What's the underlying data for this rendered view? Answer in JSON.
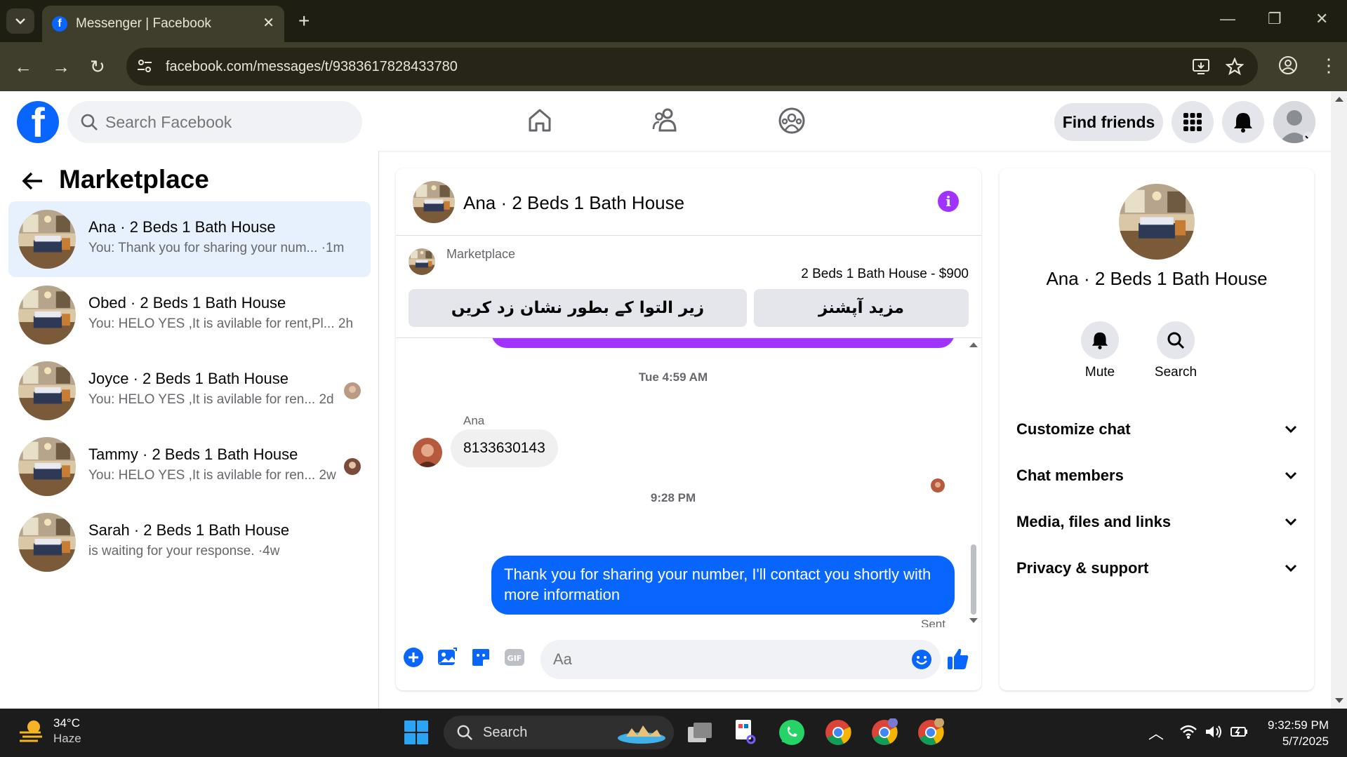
{
  "browser": {
    "tab_title": "Messenger | Facebook",
    "url": "facebook.com/messages/t/9383617828433780"
  },
  "header": {
    "search_placeholder": "Search Facebook",
    "find_friends": "Find friends"
  },
  "sidebar": {
    "title": "Marketplace",
    "conversations": [
      {
        "name": "Ana · 2 Beds 1 Bath House",
        "preview": "You: Thank you for sharing your num... ·1m",
        "active": true
      },
      {
        "name": "Obed · 2 Beds 1 Bath House",
        "preview": "You: HELO YES ,It is avilable for rent,Pl...  2h"
      },
      {
        "name": "Joyce · 2 Beds 1 Bath House",
        "preview": "You: HELO YES ,It is avilable for ren...  2d"
      },
      {
        "name": "Tammy · 2 Beds 1 Bath House",
        "preview": "You: HELO YES ,It is avilable for ren...  2w"
      },
      {
        "name": "Sarah · 2 Beds 1 Bath House",
        "preview": "is waiting for your response. ·4w"
      }
    ]
  },
  "chat": {
    "title": "Ana · 2 Beds 1 Bath House",
    "marketplace_label": "Marketplace",
    "listing_price": "2 Beds 1 Bath House - $900",
    "btn_mark_pending": "زیر التوا کے بطور نشان زد کریں",
    "btn_more_options": "مزید آپشنز",
    "timestamp_1": "Tue 4:59 AM",
    "sender_name": "Ana",
    "incoming_message": "8133630143",
    "timestamp_2": "9:28 PM",
    "outgoing_message": "Thank you for sharing your number, I'll contact you shortly with more information",
    "status": "Sent",
    "input_placeholder": "Aa"
  },
  "info_panel": {
    "name": "Ana · 2 Beds 1 Bath House",
    "mute": "Mute",
    "search": "Search",
    "sections": [
      "Customize chat",
      "Chat members",
      "Media, files and links",
      "Privacy & support"
    ]
  },
  "taskbar": {
    "temperature": "34°C",
    "weather": "Haze",
    "search": "Search",
    "time": "9:32:59 PM",
    "date": "5/7/2025"
  },
  "colors": {
    "facebook_blue": "#0866ff",
    "purple_accent": "#a033ff",
    "active_conversation_bg": "#e7f0fd"
  }
}
